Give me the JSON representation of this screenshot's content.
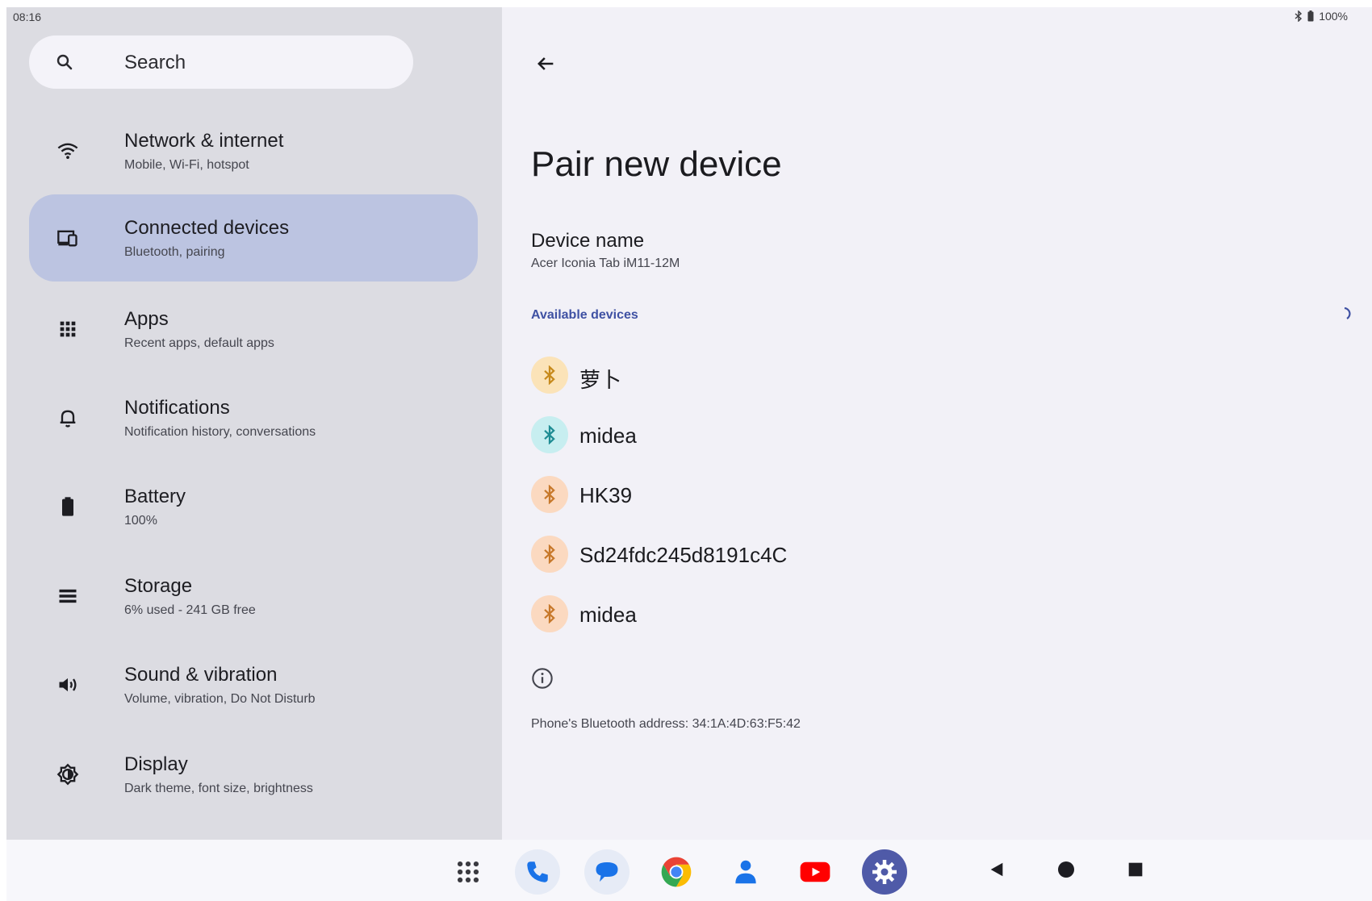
{
  "status_bar": {
    "time": "08:16",
    "battery": "100%"
  },
  "search": {
    "placeholder": "Search"
  },
  "sidebar": {
    "items": [
      {
        "title": "Network & internet",
        "subtitle": "Mobile, Wi-Fi, hotspot",
        "icon": "wifi-icon"
      },
      {
        "title": "Connected devices",
        "subtitle": "Bluetooth, pairing",
        "icon": "devices-icon",
        "active": true
      },
      {
        "title": "Apps",
        "subtitle": "Recent apps, default apps",
        "icon": "apps-grid-icon"
      },
      {
        "title": "Notifications",
        "subtitle": "Notification history, conversations",
        "icon": "bell-icon"
      },
      {
        "title": "Battery",
        "subtitle": "100%",
        "icon": "battery-icon"
      },
      {
        "title": "Storage",
        "subtitle": "6% used - 241 GB free",
        "icon": "storage-icon"
      },
      {
        "title": "Sound & vibration",
        "subtitle": "Volume, vibration, Do Not Disturb",
        "icon": "volume-icon"
      },
      {
        "title": "Display",
        "subtitle": "Dark theme, font size, brightness",
        "icon": "display-icon"
      }
    ]
  },
  "main": {
    "title": "Pair new device",
    "device_name_label": "Device name",
    "device_name_value": "Acer Iconia Tab iM11-12M",
    "available_label": "Available devices",
    "devices": [
      {
        "name": "萝卜",
        "bg": "#fbe3b8",
        "fg": "#c78a1c"
      },
      {
        "name": "midea",
        "bg": "#c7eef0",
        "fg": "#1f8c93"
      },
      {
        "name": "HK39",
        "bg": "#fbd9c0",
        "fg": "#c7782a"
      },
      {
        "name": "Sd24fdc245d8191c4C",
        "bg": "#fbd9c0",
        "fg": "#c7782a"
      },
      {
        "name": "midea",
        "bg": "#fbd9c0",
        "fg": "#c7782a"
      }
    ],
    "bt_address": "Phone's Bluetooth address: 34:1A:4D:63:F5:42"
  },
  "taskbar": {
    "apps": [
      "all-apps-icon",
      "phone-icon",
      "messages-icon",
      "chrome-icon",
      "contacts-icon",
      "youtube-icon",
      "settings-icon"
    ],
    "nav": [
      "back-nav-icon",
      "home-nav-icon",
      "recents-nav-icon"
    ]
  },
  "colors": {
    "accent": "#3f51a3",
    "active_item": "#bcc4e1"
  }
}
